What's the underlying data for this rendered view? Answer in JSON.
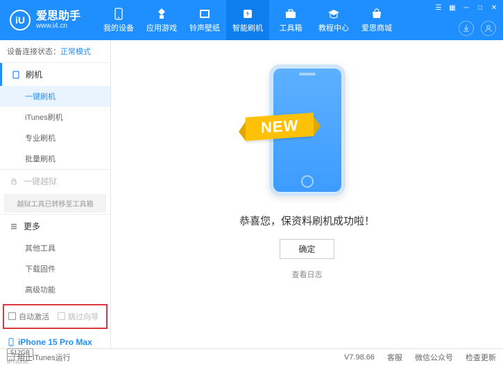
{
  "app": {
    "title": "爱思助手",
    "subtitle": "www.i4.cn",
    "logo_letter": "iU"
  },
  "nav": [
    {
      "label": "我的设备"
    },
    {
      "label": "应用游戏"
    },
    {
      "label": "铃声壁纸"
    },
    {
      "label": "智能刷机"
    },
    {
      "label": "工具箱"
    },
    {
      "label": "教程中心"
    },
    {
      "label": "爱思商城"
    }
  ],
  "nav_active_index": 3,
  "status": {
    "label": "设备连接状态：",
    "value": "正常模式"
  },
  "sidebar": {
    "flash": {
      "title": "刷机",
      "items": [
        "一键刷机",
        "iTunes刷机",
        "专业刷机",
        "批量刷机"
      ],
      "active_index": 0
    },
    "jailbreak": {
      "title": "一键越狱",
      "note": "越狱工具已转移至工具箱"
    },
    "more": {
      "title": "更多",
      "items": [
        "其他工具",
        "下载固件",
        "高级功能"
      ]
    }
  },
  "options": {
    "auto_activate": "自动激活",
    "skip_guide": "跳过向导"
  },
  "device": {
    "name": "iPhone 15 Pro Max",
    "storage": "512GB",
    "type": "iPhone"
  },
  "main": {
    "ribbon": "NEW",
    "success": "恭喜您，保资料刷机成功啦！",
    "ok": "确定",
    "view_log": "查看日志"
  },
  "footer": {
    "block_itunes": "阻止iTunes运行",
    "version": "V7.98.66",
    "support": "客服",
    "wechat": "微信公众号",
    "check_update": "检查更新"
  }
}
